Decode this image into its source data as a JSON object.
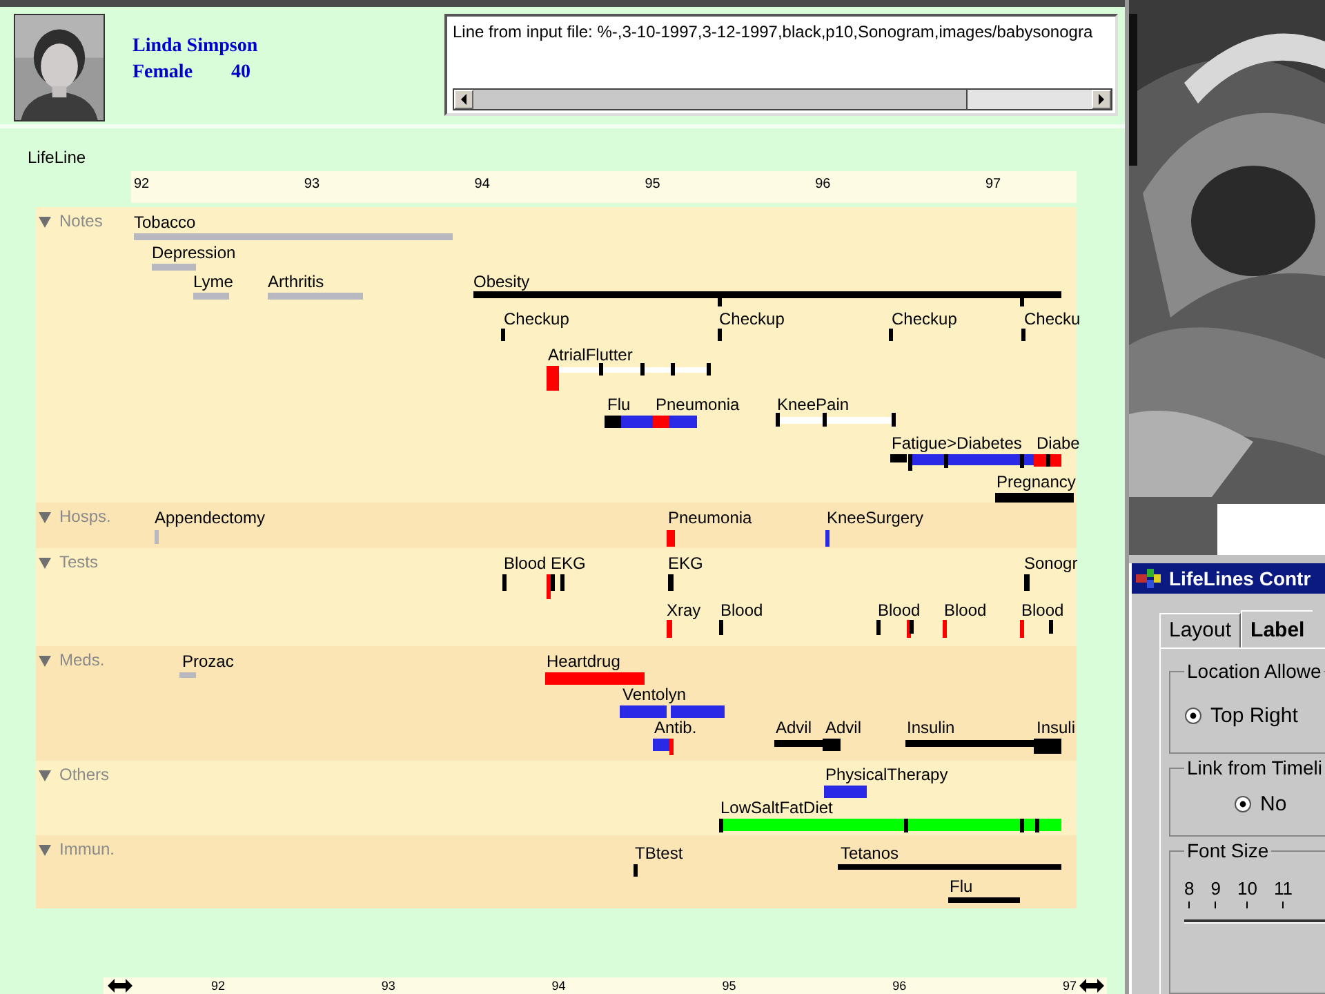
{
  "patient": {
    "name": "Linda Simpson",
    "sex": "Female",
    "age": "40"
  },
  "input_line": {
    "text": "Line from input file:  %-,3-10-1997,3-12-1997,black,p10,Sonogram,images/babysonogra"
  },
  "timeline": {
    "title": "LifeLine",
    "axis": [
      "92",
      "93",
      "94",
      "95",
      "96",
      "97"
    ],
    "categories": [
      {
        "label": "Notes",
        "expanded": true,
        "events": [
          {
            "label": "Tobacco",
            "segments": [
              {
                "color": "#b8b8c0"
              }
            ]
          },
          {
            "label": "Depression",
            "segments": [
              {
                "color": "#b8b8c0"
              }
            ]
          },
          {
            "label": "Lyme",
            "segments": [
              {
                "color": "#b8b8c0"
              }
            ]
          },
          {
            "label": "Arthritis",
            "segments": [
              {
                "color": "#b8b8c0"
              }
            ]
          },
          {
            "label": "Obesity",
            "segments": [
              {
                "color": "#000000"
              }
            ]
          },
          {
            "label": "Checkup",
            "segments": [
              {
                "color": "#000000"
              }
            ]
          },
          {
            "label": "Checkup",
            "segments": [
              {
                "color": "#000000"
              }
            ]
          },
          {
            "label": "Checkup",
            "segments": [
              {
                "color": "#000000"
              }
            ]
          },
          {
            "label": "Checku",
            "segments": [
              {
                "color": "#000000"
              }
            ]
          },
          {
            "label": "AtrialFlutter",
            "segments": [
              {
                "color": "#ff0000"
              },
              {
                "color": "#ffffff"
              }
            ]
          },
          {
            "label": "Flu",
            "segments": [
              {
                "color": "#000000"
              },
              {
                "color": "#2a2ae6"
              }
            ]
          },
          {
            "label": "Pneumonia",
            "segments": [
              {
                "color": "#ff0000"
              },
              {
                "color": "#2a2ae6"
              }
            ]
          },
          {
            "label": "KneePain",
            "segments": [
              {
                "color": "#ffffff"
              }
            ]
          },
          {
            "label": "Fatigue>Diabetes",
            "segments": [
              {
                "color": "#000000"
              },
              {
                "color": "#2a2ae6"
              }
            ]
          },
          {
            "label": "Diabe",
            "segments": [
              {
                "color": "#ff0000"
              }
            ]
          },
          {
            "label": "Pregnancy",
            "segments": [
              {
                "color": "#000000"
              }
            ]
          }
        ]
      },
      {
        "label": "Hosps.",
        "expanded": true,
        "events": [
          {
            "label": "Appendectomy",
            "segments": [
              {
                "color": "#b8b8c0"
              }
            ]
          },
          {
            "label": "Pneumonia",
            "segments": [
              {
                "color": "#ff0000"
              }
            ]
          },
          {
            "label": "KneeSurgery",
            "segments": [
              {
                "color": "#2a2ae6"
              }
            ]
          }
        ]
      },
      {
        "label": "Tests",
        "expanded": true,
        "events": [
          {
            "label": "Blood",
            "segments": [
              {
                "color": "#000000"
              }
            ]
          },
          {
            "label": "EKG",
            "segments": [
              {
                "color": "#ff0000"
              }
            ]
          },
          {
            "label": "EKG",
            "segments": [
              {
                "color": "#000000"
              }
            ]
          },
          {
            "label": "Sonogr",
            "segments": [
              {
                "color": "#000000"
              }
            ]
          },
          {
            "label": "Xray",
            "segments": [
              {
                "color": "#ff0000"
              }
            ]
          },
          {
            "label": "Blood",
            "segments": [
              {
                "color": "#000000"
              }
            ]
          },
          {
            "label": "Blood",
            "segments": [
              {
                "color": "#000000"
              },
              {
                "color": "#ff0000"
              }
            ]
          },
          {
            "label": "Blood",
            "segments": [
              {
                "color": "#ff0000"
              }
            ]
          },
          {
            "label": "Blood",
            "segments": [
              {
                "color": "#ff0000"
              }
            ]
          }
        ]
      },
      {
        "label": "Meds.",
        "expanded": true,
        "events": [
          {
            "label": "Prozac",
            "segments": [
              {
                "color": "#b8b8c0"
              }
            ]
          },
          {
            "label": "Heartdrug",
            "segments": [
              {
                "color": "#ff0000"
              }
            ]
          },
          {
            "label": "Ventolyn",
            "segments": [
              {
                "color": "#2a2ae6"
              }
            ]
          },
          {
            "label": "Antib.",
            "segments": [
              {
                "color": "#2a2ae6"
              },
              {
                "color": "#ff0000"
              }
            ]
          },
          {
            "label": "Advil",
            "segments": [
              {
                "color": "#000000"
              }
            ]
          },
          {
            "label": "Advil",
            "segments": [
              {
                "color": "#000000"
              }
            ]
          },
          {
            "label": "Insulin",
            "segments": [
              {
                "color": "#000000"
              }
            ]
          },
          {
            "label": "Insuli",
            "segments": [
              {
                "color": "#000000"
              }
            ]
          }
        ]
      },
      {
        "label": "Others",
        "expanded": true,
        "events": [
          {
            "label": "PhysicalTherapy",
            "segments": [
              {
                "color": "#2a2ae6"
              }
            ]
          },
          {
            "label": "LowSaltFatDiet",
            "segments": [
              {
                "color": "#00ff00"
              }
            ]
          }
        ]
      },
      {
        "label": "Immun.",
        "expanded": true,
        "events": [
          {
            "label": "TBtest",
            "segments": [
              {
                "color": "#000000"
              }
            ]
          },
          {
            "label": "Tetanos",
            "segments": [
              {
                "color": "#000000"
              }
            ]
          },
          {
            "label": "Flu",
            "segments": [
              {
                "color": "#000000"
              }
            ]
          }
        ]
      }
    ],
    "bottom_axis": [
      "92",
      "93",
      "94",
      "95",
      "96",
      "97"
    ]
  },
  "control_panel": {
    "title": "LifeLines Contr",
    "tabs": [
      {
        "label": "Layout",
        "selected": false
      },
      {
        "label": "Label",
        "selected": true
      }
    ],
    "groups": [
      {
        "title": "Location Allowe",
        "options": [
          {
            "label": "Top Right",
            "selected": true
          }
        ]
      },
      {
        "title": "Link from Timeli",
        "options": [
          {
            "label": "No",
            "selected": true
          }
        ]
      }
    ],
    "font_size": {
      "title": "Font Size",
      "scale": [
        "8",
        "9",
        "10",
        "11"
      ]
    }
  }
}
